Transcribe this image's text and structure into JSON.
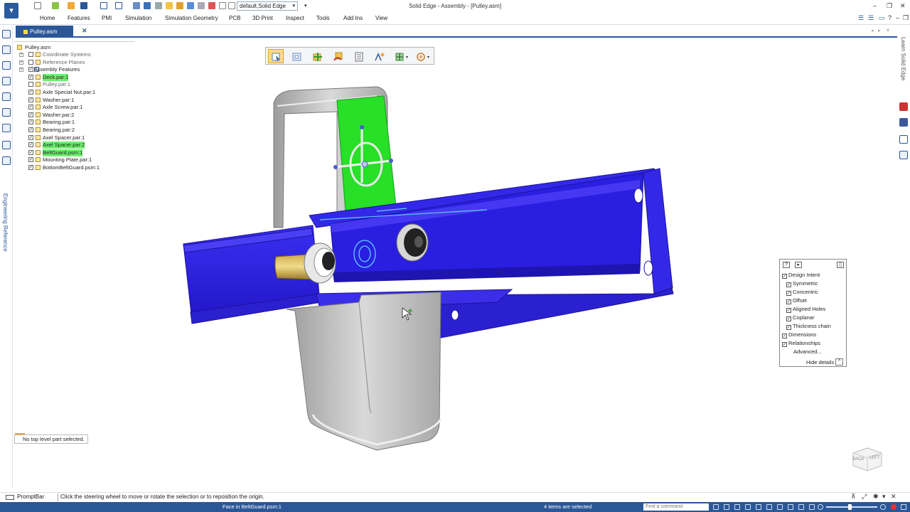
{
  "window": {
    "title": "Solid Edge - Assembly - [Pulley.asm]",
    "profile": "default,Solid Edge"
  },
  "ribbon": {
    "tabs": [
      "Home",
      "Features",
      "PMI",
      "Simulation",
      "Simulation Geometry",
      "PCB",
      "3D Print",
      "Inspect",
      "Tools",
      "Add Ins",
      "View"
    ]
  },
  "doc_tab": {
    "label": "Pulley.asm"
  },
  "side_labels": {
    "left": "Engineering Reference",
    "right": "Learn Solid Edge"
  },
  "pathfinder": {
    "root": "Pulley.asm",
    "items": [
      {
        "label": "Coordinate Systems",
        "checked": false,
        "style": "gray",
        "expand": true
      },
      {
        "label": "Reference Planes",
        "checked": false,
        "style": "gray",
        "expand": true
      },
      {
        "label": "Assembly Features",
        "checked": true,
        "style": "normal",
        "expand": true,
        "outer": true
      },
      {
        "label": "Deck.par:1",
        "checked": true,
        "style": "highlight"
      },
      {
        "label": "Pulley.par:1",
        "checked": false,
        "style": "gray"
      },
      {
        "label": "Axle Special Nut.par:1",
        "checked": true,
        "style": "normal"
      },
      {
        "label": "Washer.par:1",
        "checked": true,
        "style": "normal"
      },
      {
        "label": "Axle Screw.par:1",
        "checked": true,
        "style": "normal"
      },
      {
        "label": "Washer.par:2",
        "checked": true,
        "style": "normal"
      },
      {
        "label": "Bearing.par:1",
        "checked": true,
        "style": "normal"
      },
      {
        "label": "Bearing.par:2",
        "checked": true,
        "style": "normal"
      },
      {
        "label": "Axel Spacer.par:1",
        "checked": true,
        "style": "normal"
      },
      {
        "label": "Axel Spacer.par:2",
        "checked": true,
        "style": "highlight"
      },
      {
        "label": "BeltGuard.psm:1",
        "checked": true,
        "style": "highlight"
      },
      {
        "label": "Mounting Plate.par:1",
        "checked": true,
        "style": "normal"
      },
      {
        "label": "BottomBeltGuard.psm:1",
        "checked": true,
        "style": "normal"
      }
    ]
  },
  "selection_message": "No top level part selected.",
  "design_intent": {
    "items": [
      {
        "label": "Design Intent",
        "checked": true,
        "indent": 0
      },
      {
        "label": "Symmetric",
        "checked": true,
        "indent": 1
      },
      {
        "label": "Concentric",
        "checked": true,
        "indent": 1
      },
      {
        "label": "Offset",
        "checked": true,
        "indent": 1
      },
      {
        "label": "Aligned Holes",
        "checked": true,
        "indent": 1
      },
      {
        "label": "Coplanar",
        "checked": true,
        "indent": 1
      },
      {
        "label": "Thickness chain",
        "checked": true,
        "indent": 1
      },
      {
        "label": "Dimensions",
        "checked": true,
        "indent": 0
      },
      {
        "label": "Relationships",
        "checked": true,
        "indent": 0
      }
    ],
    "advanced": "Advanced...",
    "hide_details": "Hide details"
  },
  "view_cube": {
    "back": "BACK",
    "left": "LEFT"
  },
  "prompt": {
    "label": "PromptBar",
    "message": "Click the steering wheel to move or rotate the selection or to reposition the origin."
  },
  "status": {
    "face": "Face in BeltGuard.psm:1",
    "items_selected": "4 items are selected",
    "command_placeholder": "Find a command"
  },
  "colors": {
    "accent": "#2b5797",
    "part_blue": "#2a1fe0",
    "selected_green": "#27e027",
    "highlight_green": "#6ef06e"
  }
}
